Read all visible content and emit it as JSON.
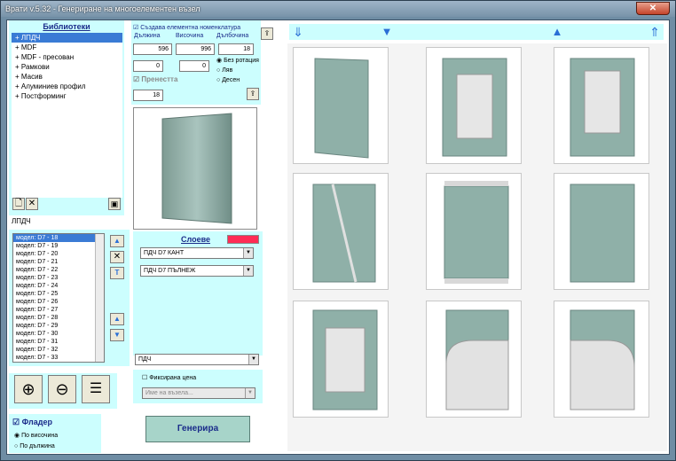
{
  "window": {
    "title": "Врати v.5.32 - Генериране на многоелементен възел",
    "close": "✕"
  },
  "libraries": {
    "header": "Библиотеки",
    "items": [
      "ЛПДЧ",
      "MDF",
      "MDF - пресован",
      "Рамкови",
      "Масив",
      "Алуминиев профил",
      "Постформинг"
    ],
    "selected": "ЛПДЧ"
  },
  "models": [
    "модел: D7 - 18",
    "модел: D7 - 19",
    "модел: D7 - 20",
    "модел: D7 - 21",
    "модел: D7 - 22",
    "модел: D7 - 23",
    "модел: D7 - 24",
    "модел: D7 - 25",
    "модел: D7 - 26",
    "модел: D7 - 27",
    "модел: D7 - 28",
    "модел: D7 - 29",
    "модел: D7 - 30",
    "модел: D7 - 31",
    "модел: D7 - 32",
    "модел: D7 - 33"
  ],
  "params": {
    "create_nomenclature": "Създава елементна номенклатура",
    "length_label": "Дължина",
    "height_label": "Височина",
    "depth_label": "Дълбочина",
    "length": "596",
    "height": "996",
    "depth": "18",
    "offset1": "0",
    "offset2": "0",
    "rot_none": "Без ротация",
    "rot_left": "Ляв",
    "rot_right": "Десен",
    "transfer": "Пренестта",
    "transfer_val": "18"
  },
  "layers": {
    "title": "Слоеве",
    "row1": "ПДЧ D7 КАНТ",
    "row2": "ПДЧ D7 ПЪЛНЕЖ",
    "accent": "#ff2d55"
  },
  "material": "ПДЧ",
  "fixed_price": "Фиксирана цена",
  "node_name_placeholder": "Име на възела...",
  "generate": "Генерира",
  "flader": {
    "label": "Фладер",
    "by_height": "По височина",
    "by_length": "По дължина"
  },
  "colors": {
    "cyan": "#ccfefe",
    "panel": "#a7d4c9"
  }
}
